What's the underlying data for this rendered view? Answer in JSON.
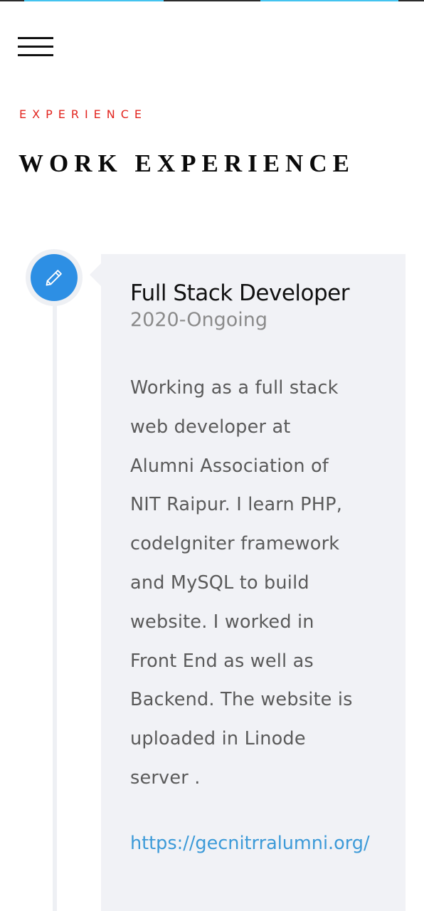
{
  "nav": {
    "menu_icon": "hamburger-menu-icon"
  },
  "section": {
    "eyebrow": "EXPERIENCE",
    "title": "WORK EXPERIENCE"
  },
  "entry": {
    "icon": "pencil-icon",
    "title": "Full Stack Developer",
    "period": "2020-Ongoing",
    "description_lines": [
      "Working as a full stack",
      "web developer at",
      "Alumni Association of",
      "NIT Raipur. I learn PHP,",
      "codeIgniter framework",
      "and MySQL to build",
      "website. I worked in",
      "Front End as well as",
      "Backend. The website is",
      "uploaded in Linode",
      "server ."
    ],
    "link": "https://gecnitrralumni.org/"
  },
  "colors": {
    "accent_red": "#e2251f",
    "icon_blue": "#2d8fe4",
    "link_blue": "#3c9ad8",
    "card_bg": "#f1f2f6"
  }
}
